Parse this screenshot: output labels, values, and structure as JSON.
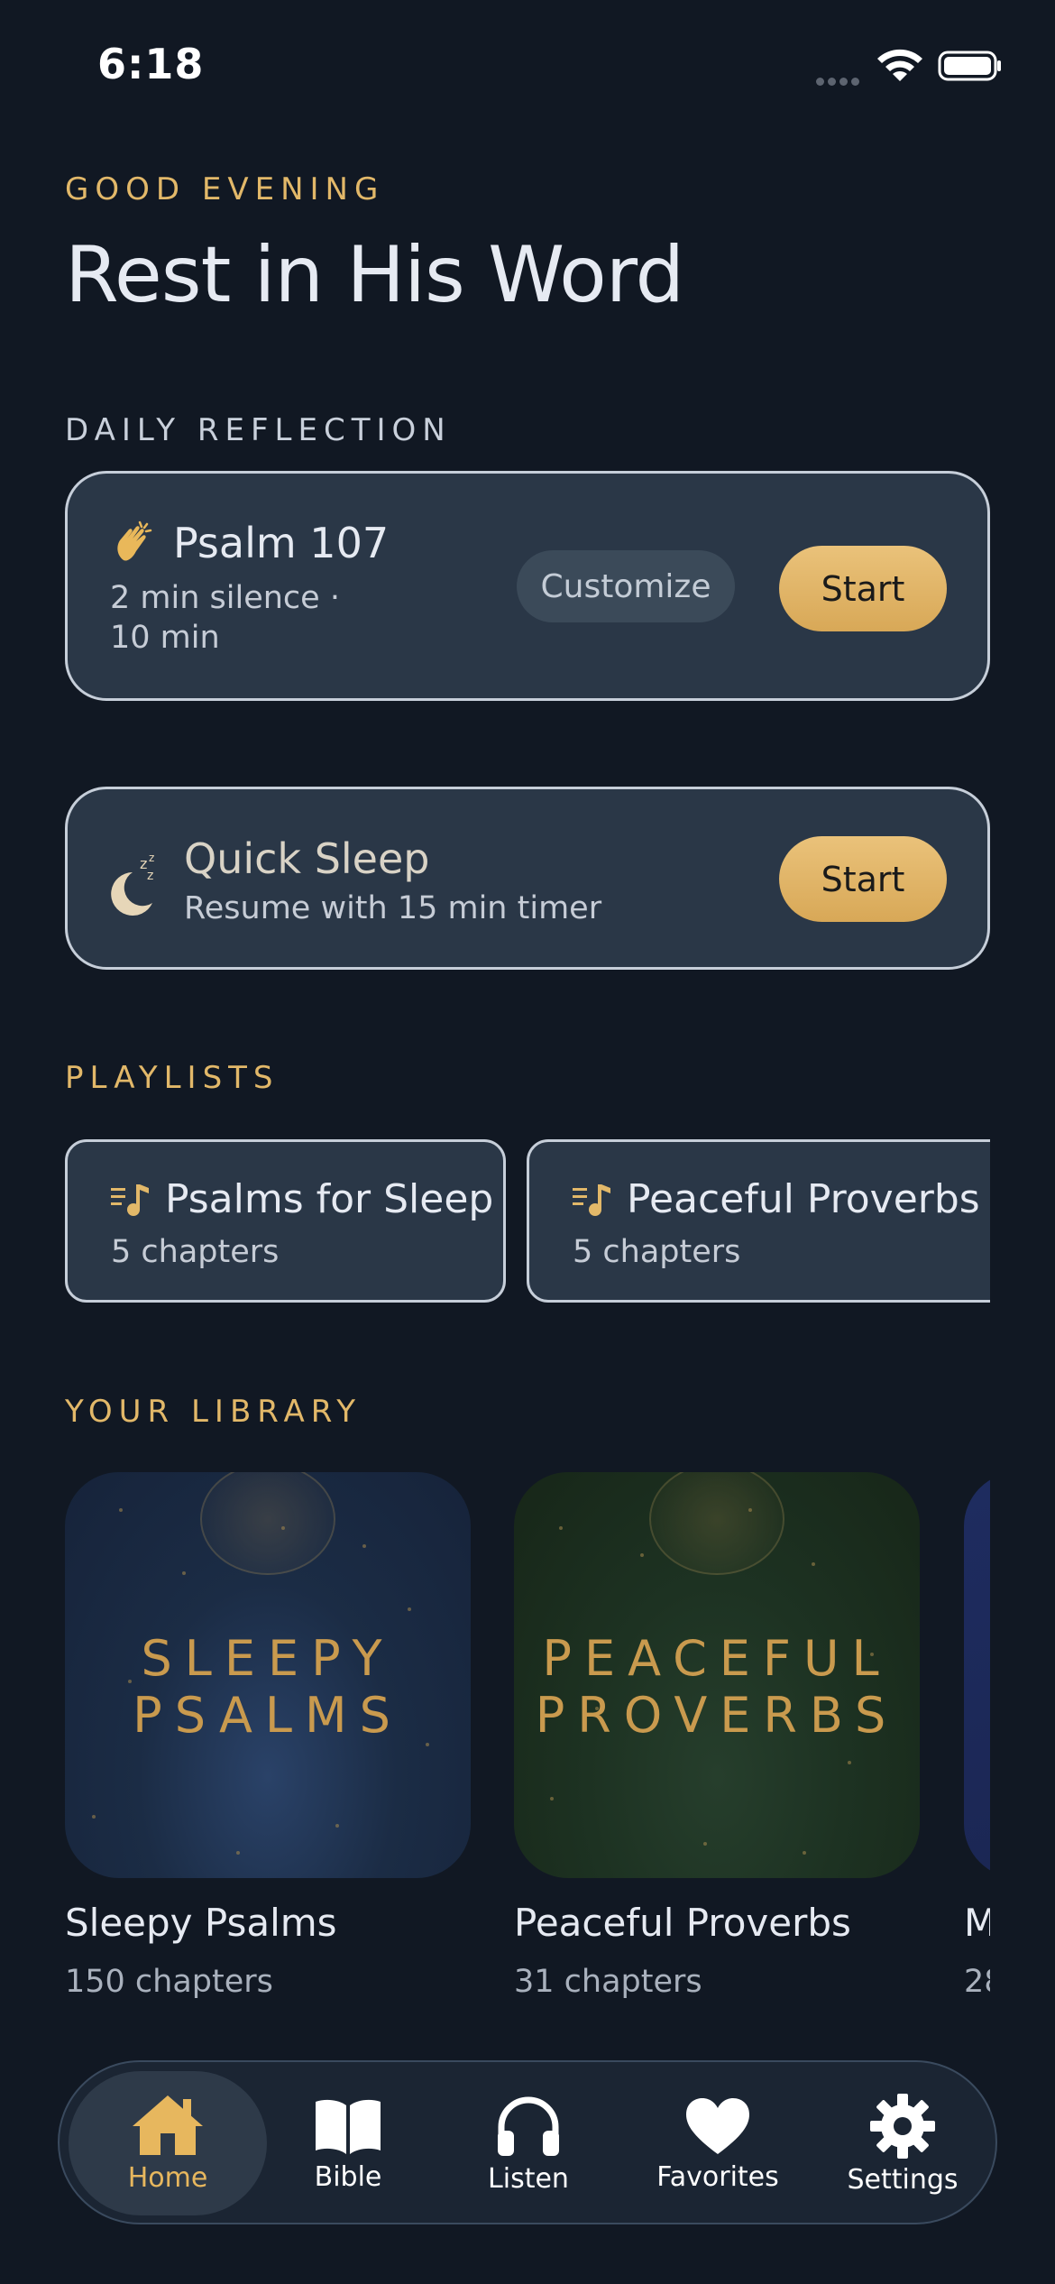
{
  "status_bar": {
    "time": "6:18"
  },
  "greeting": {
    "eyebrow": "GOOD EVENING",
    "headline": "Rest in His Word"
  },
  "daily_reflection": {
    "label": "DAILY REFLECTION",
    "title": "Psalm 107",
    "line1": "2 min silence ·",
    "line2": "10 min",
    "customize": "Customize",
    "start": "Start"
  },
  "quick_sleep": {
    "title": "Quick Sleep",
    "subtitle": "Resume with 15 min timer",
    "start": "Start"
  },
  "playlists": {
    "label": "PLAYLISTS",
    "items": [
      {
        "title": "Psalms for Sleep",
        "count": "5 chapters"
      },
      {
        "title": "Peaceful Proverbs",
        "count": "5 chapters"
      }
    ]
  },
  "library": {
    "label": "YOUR LIBRARY",
    "items": [
      {
        "cover_line1": "SLEEPY",
        "cover_line2": "PSALMS",
        "title": "Sleepy Psalms",
        "count": "150 chapters"
      },
      {
        "cover_line1": "PEACEFUL",
        "cover_line2": "PROVERBS",
        "title": "Peaceful Proverbs",
        "count": "31 chapters"
      },
      {
        "title": "M",
        "count": "28"
      }
    ]
  },
  "tabs": [
    {
      "label": "Home",
      "icon": "house-icon",
      "active": true
    },
    {
      "label": "Bible",
      "icon": "book-icon",
      "active": false
    },
    {
      "label": "Listen",
      "icon": "headphones-icon",
      "active": false
    },
    {
      "label": "Favorites",
      "icon": "heart-icon",
      "active": false
    },
    {
      "label": "Settings",
      "icon": "gear-icon",
      "active": false
    }
  ],
  "colors": {
    "accent": "#e2b869",
    "background": "#111823",
    "card": "#2a3747"
  }
}
